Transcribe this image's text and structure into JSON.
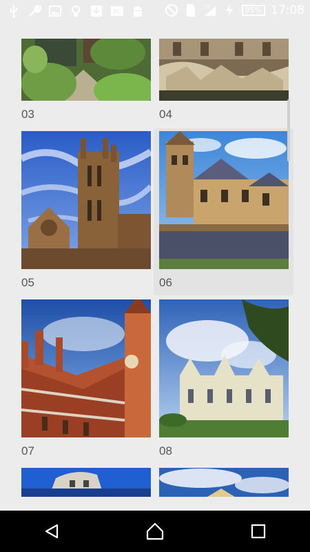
{
  "status_bar": {
    "time": "17:08",
    "battery": "85%",
    "network": "LTE",
    "icons_left": [
      "usb-icon",
      "wrench-icon",
      "image-icon",
      "lightbulb-icon",
      "download-icon",
      "pc-icon",
      "android-icon"
    ],
    "icons_right": [
      "block-icon",
      "sim-icon",
      "signal-icon",
      "charging-icon"
    ]
  },
  "gallery": {
    "items": [
      {
        "label": "03"
      },
      {
        "label": "04"
      },
      {
        "label": "05"
      },
      {
        "label": "06"
      },
      {
        "label": "07"
      },
      {
        "label": "08"
      },
      {
        "label": ""
      },
      {
        "label": ""
      }
    ]
  },
  "colors": {
    "background": "#ececec",
    "navbar": "#000000",
    "selected_tile": "#e3e3e3"
  }
}
